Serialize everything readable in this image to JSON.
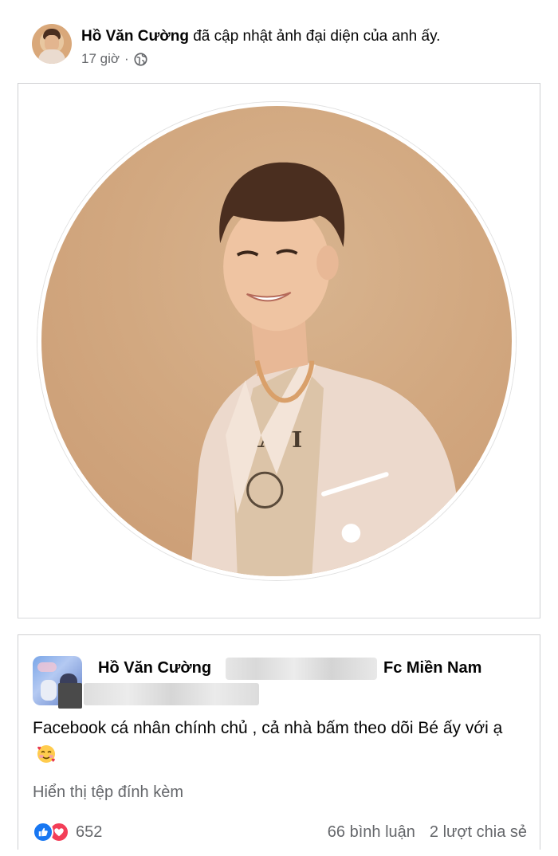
{
  "post1": {
    "author": "Hồ Văn Cường",
    "action": "đã cập nhật ảnh đại diện của anh ấy.",
    "time": "17 giờ",
    "separator": "·",
    "privacy_icon": "globe-icon"
  },
  "post2": {
    "author": "Hồ Văn Cường",
    "group": "Fc Miền Nam",
    "text": "Facebook cá nhân chính chủ , cả nhà bấm theo dõi Bé ấy với ạ",
    "emoji": "smiling-face-with-hearts",
    "attachment_link": "Hiển thị tệp đính kèm",
    "reaction_count": "652",
    "reactions": [
      "like",
      "love"
    ],
    "comments": "66 bình luận",
    "shares": "2 lượt chia sẻ"
  },
  "colors": {
    "brand_blue": "#1877f2",
    "love_red": "#f33e58",
    "secondary_text": "#65676b",
    "photo_background": "#d2a880"
  }
}
